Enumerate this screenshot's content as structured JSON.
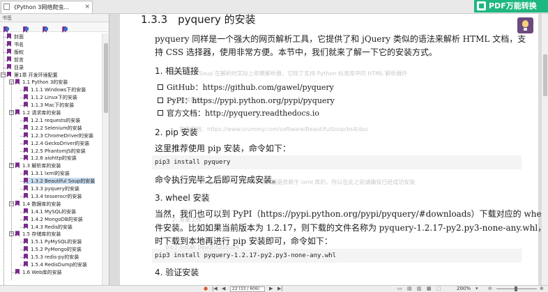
{
  "tab": {
    "title": "《Python 3网络爬虫...",
    "close": "×"
  },
  "pdf_button": {
    "label": "PDF万能转换"
  },
  "sidebar": {
    "title": "书签",
    "tools": [
      "bookmark-tool-1",
      "bookmark-tool-2",
      "bookmark-tool-3",
      "bookmark-tool-4"
    ],
    "items": [
      {
        "label": "封面",
        "level": 0
      },
      {
        "label": "书名",
        "level": 0
      },
      {
        "label": "版权",
        "level": 0
      },
      {
        "label": "前言",
        "level": 0
      },
      {
        "label": "目录",
        "level": 0
      },
      {
        "label": "第1章 开发环境配置",
        "level": 0
      },
      {
        "label": "1.1 Python 3的安装",
        "level": 1
      },
      {
        "label": "1.1.1 Windows下的安装",
        "level": 2
      },
      {
        "label": "1.1.2 Linux下的安装",
        "level": 2
      },
      {
        "label": "1.1.3 Mac下的安装",
        "level": 2
      },
      {
        "label": "1.2 请求库的安装",
        "level": 1
      },
      {
        "label": "1.2.1 requests的安装",
        "level": 2
      },
      {
        "label": "1.2.2 Selenium的安装",
        "level": 2
      },
      {
        "label": "1.2.3 ChromeDriver的安装",
        "level": 2
      },
      {
        "label": "1.2.4 GeckoDriver的安装",
        "level": 2
      },
      {
        "label": "1.2.5 PhantomJS的安装",
        "level": 2
      },
      {
        "label": "1.2.6 aiohttp的安装",
        "level": 2
      },
      {
        "label": "1.3 解析库的安装",
        "level": 1
      },
      {
        "label": "1.3.1 lxml的安装",
        "level": 2
      },
      {
        "label": "1.3.2 Beautiful Soup的安装",
        "level": 2,
        "selected": true
      },
      {
        "label": "1.3.3 pyquery的安装",
        "level": 2
      },
      {
        "label": "1.3.4 tesserocr的安装",
        "level": 2
      },
      {
        "label": "1.4 数据库的安装",
        "level": 1
      },
      {
        "label": "1.4.1 MySQL的安装",
        "level": 2
      },
      {
        "label": "1.4.2 MongoDB的安装",
        "level": 2
      },
      {
        "label": "1.4.3 Redis的安装",
        "level": 2
      },
      {
        "label": "1.5 存储库的安装",
        "level": 1
      },
      {
        "label": "1.5.1 PyMySQL的安装",
        "level": 2
      },
      {
        "label": "1.5.2 PyMongo的安装",
        "level": 2
      },
      {
        "label": "1.5.3 redis-py的安装",
        "level": 2
      },
      {
        "label": "1.5.4 RedisDump的安装",
        "level": 2
      },
      {
        "label": "1.6 Web库的安装",
        "level": 1
      }
    ]
  },
  "page": {
    "heading": "1.3.3　pyquery 的安装",
    "intro_1": "pyquery 同样是一个强大的网页解析工具，它提供了和 jQuery 类似的语法来解析 HTML 文档，支",
    "intro_2": "持 CSS 选择器，使用非常方便。本节中，我们就来了解一下它的安装方式。",
    "s1_title": "1. 相关链接",
    "links": [
      "GitHub：https://github.com/gawel/pyquery",
      "PyPI：https://pypi.python.org/pypi/pyquery",
      "官方文档：http://pyquery.readthedocs.io"
    ],
    "s2_title": "2. pip 安装",
    "s2_text": "这里推荐使用 pip 安装，命令如下：",
    "s2_code": "pip3 install pyquery",
    "s2_after": "命令执行完毕之后即可完成安装。",
    "s3_title": "3. wheel 安装",
    "s3_text_1": "当然，我们也可以到 PyPI（https://pypi.python.org/pypi/pyquery/#downloads）下载对应的 wheel 文",
    "s3_text_2": "件安装。比如如果当前版本为 1.2.17，则下载的文件名称为 pyquery-1.2.17-py2.py3-none-any.whl，此",
    "s3_text_3": "时下载到本地再进行 pip 安装即可，命令如下：",
    "s3_code": "pip3 install pyquery-1.2.17-py2.py3-none-any.whl",
    "s4_title": "4. 验证安装"
  },
  "statusbar": {
    "page_indicator": "22 (33 / 606)",
    "zoom": "200%"
  }
}
